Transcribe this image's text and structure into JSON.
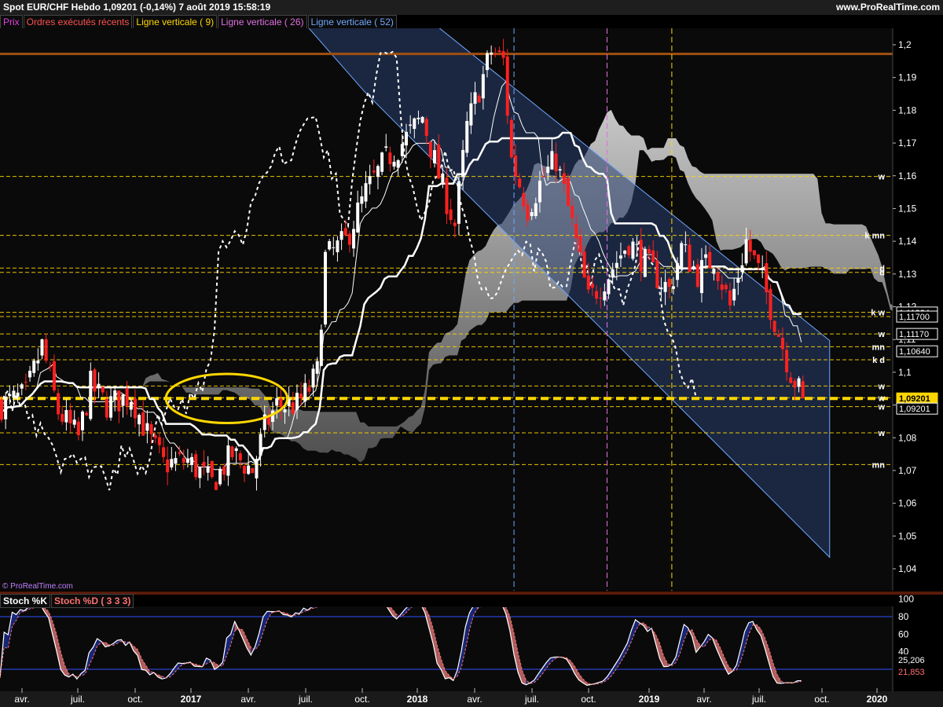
{
  "header": {
    "title": "Spot EUR/CHF    Hebdo    1,09201 (-0,14%)    7 août 2019 15:58:19",
    "site": "www.ProRealTime.com"
  },
  "legend": [
    {
      "label": "Prix",
      "color": "#e040e0"
    },
    {
      "label": "Ordres exécutés récents",
      "color": "#ff5050"
    },
    {
      "label": "Ligne verticale ( 9)",
      "color": "#ffd700"
    },
    {
      "label": "Ligne verticale ( 26)",
      "color": "#e070e0"
    },
    {
      "label": "Ligne verticale ( 52)",
      "color": "#6fa8ff"
    }
  ],
  "copyright": "© ProRealTime.com",
  "stoch_legend": [
    {
      "label": "Stoch %K",
      "color": "#ffffff"
    },
    {
      "label": "Stoch %D ( 3 3 3)",
      "color": "#ff7070"
    }
  ],
  "colors": {
    "up": "#ffffff",
    "down": "#ff2020",
    "channel": "#6fa8ff",
    "dashed_yellow": "#ffd700",
    "resistance": "#a05010"
  },
  "chart_data": [
    {
      "type": "candlestick",
      "title": "Spot EUR/CHF Hebdo",
      "y_ticks": [
        "1,2",
        "1,19",
        "1,18",
        "1,17",
        "1,16",
        "1,15",
        "1,14",
        "1,13",
        "1,12",
        "1,11",
        "1,1",
        "1,09",
        "1,08",
        "1,07",
        "1,06",
        "1,05",
        "1,04"
      ],
      "ylim": [
        1.036,
        1.206
      ],
      "x_labels": [
        "avr.",
        "juil.",
        "oct.",
        "2017",
        "avr.",
        "juil.",
        "oct.",
        "2018",
        "avr.",
        "juil.",
        "oct.",
        "2019",
        "avr.",
        "juil.",
        "oct.",
        "2020"
      ],
      "last_price": 1.09201,
      "price_labels": [
        {
          "value": 1.11824,
          "text": "1,11824"
        },
        {
          "value": 1.117,
          "text": "1,11700"
        },
        {
          "value": 1.1117,
          "text": "1,11170"
        },
        {
          "value": 1.1064,
          "text": "1,10640"
        },
        {
          "value": 1.09201,
          "text": "1,09201",
          "highlight": true
        },
        {
          "value": 1.09201,
          "text": "1,09201"
        }
      ],
      "level_lines": [
        {
          "value": 1.1598,
          "tag": "w"
        },
        {
          "value": 1.1418,
          "tag": "k mn"
        },
        {
          "value": 1.1318,
          "tag": "d"
        },
        {
          "value": 1.1305,
          "tag": "d"
        },
        {
          "value": 1.1183,
          "tag": "k w"
        },
        {
          "value": 1.117,
          "tag": ""
        },
        {
          "value": 1.1117,
          "tag": "w"
        },
        {
          "value": 1.1078,
          "tag": "mn"
        },
        {
          "value": 1.1038,
          "tag": "k d"
        },
        {
          "value": 1.0958,
          "tag": "w"
        },
        {
          "value": 1.0922,
          "tag": "w"
        },
        {
          "value": 1.0895,
          "tag": "w"
        },
        {
          "value": 1.0815,
          "tag": "w"
        },
        {
          "value": 1.0718,
          "tag": "mn"
        }
      ],
      "resistance": 1.1972,
      "support": 1.092,
      "vertical_lines": [
        {
          "x_week": 127,
          "name": "Ligne verticale ( 9)",
          "color": "#6fa8ff"
        },
        {
          "x_week": 150,
          "name": "Ligne verticale ( 26)",
          "color": "#e070e0"
        },
        {
          "x_week": 166,
          "name": "Ligne verticale ( 52)",
          "color": "#ffd700"
        }
      ],
      "channel": {
        "top": [
          [
            0,
            1.3125
          ],
          [
            113,
            1.2006
          ],
          [
            205,
            1.1097
          ]
        ],
        "bottom": [
          [
            90,
            1.1858
          ],
          [
            205,
            1.0435
          ]
        ]
      },
      "ellipse": {
        "center_week": 56,
        "center_value": 1.092,
        "span_weeks": 30,
        "span_value": 0.015
      }
    },
    {
      "type": "line",
      "title": "Stoch %K / Stoch %D (3 3 3)",
      "y_ticks": [
        "100",
        "80",
        "60",
        "40"
      ],
      "ylim": [
        0,
        100
      ],
      "guides": [
        80,
        20
      ],
      "k_value": "25,206",
      "d_value": "21,853"
    }
  ]
}
